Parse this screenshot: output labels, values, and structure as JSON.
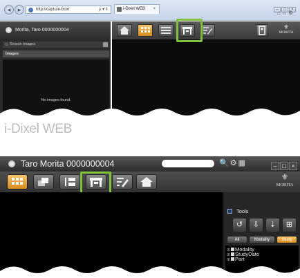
{
  "top_screen": {
    "address_url": "http://capture-box/",
    "address_controls": "ρ ▾ ¢",
    "browser_tab_title": "i-Dixel WEB",
    "user_label": "Morita, Taro  0000000004",
    "search_label": "Search Images",
    "images_header": "Images",
    "empty_message": "No images found.",
    "logo": "MORITA"
  },
  "caption": "i-Dixel WEB",
  "bottom_screen": {
    "title": "Taro Morita   0000000004",
    "logo": "MORITA",
    "tools_label": "Tools",
    "filter_tabs": [
      {
        "label": "All",
        "active": false
      },
      {
        "label": "Modality",
        "active": false
      },
      {
        "label": "Study",
        "active": true
      }
    ],
    "tree_items": [
      {
        "label": "Modality"
      },
      {
        "label": "StudyDate"
      },
      {
        "label": "Part"
      }
    ]
  },
  "colors": {
    "highlight": "#7fc13a",
    "accent_orange": "#e9a43a",
    "dark_bg": "#1a1a1a"
  }
}
